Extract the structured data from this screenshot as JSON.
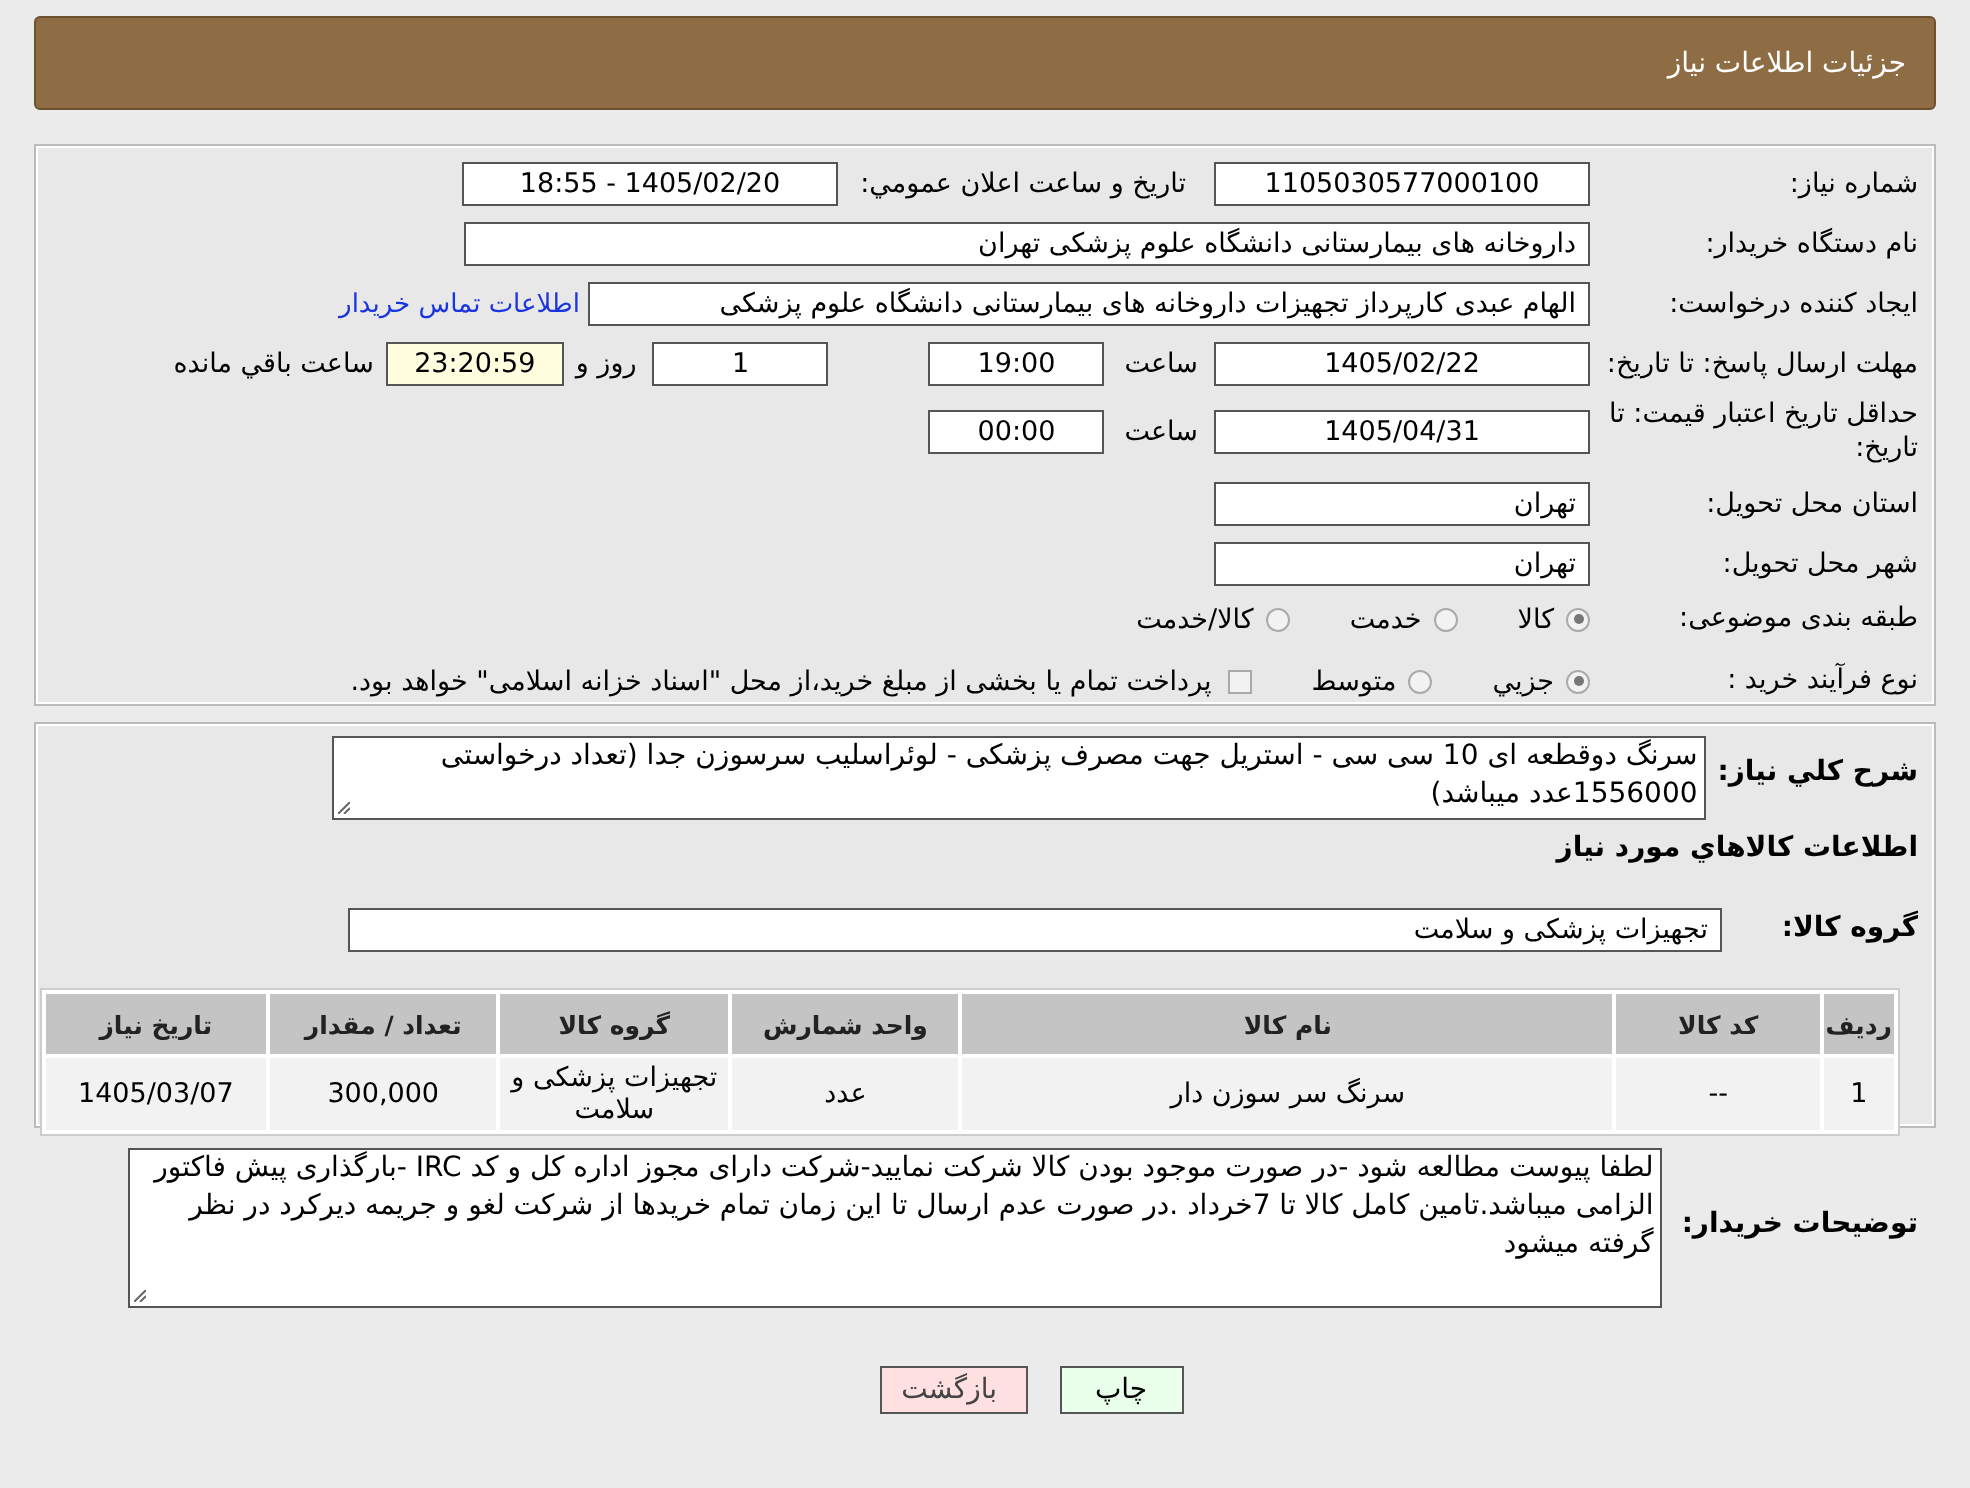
{
  "header": {
    "title": "جزئیات اطلاعات نیاز"
  },
  "form": {
    "need_number": {
      "label": "شماره نیاز:",
      "value": "1105030577000100"
    },
    "announce_datetime": {
      "label": "تاریخ و ساعت اعلان عمومي:",
      "value": "1405/02/20 - 18:55"
    },
    "buyer_org": {
      "label": "نام دستگاه خریدار:",
      "value": "داروخانه های بیمارستانی دانشگاه علوم پزشکی تهران"
    },
    "requester": {
      "label": "ایجاد کننده درخواست:",
      "value": "الهام عبدی کارپرداز تجهیزات داروخانه های بیمارستانی دانشگاه علوم پزشکی",
      "contact_link": "اطلاعات تماس خریدار"
    },
    "reply_deadline": {
      "label": "مهلت ارسال پاسخ: تا تاریخ:",
      "date": "1405/02/22",
      "time_label": "ساعت",
      "time": "19:00",
      "days": "1",
      "days_label": "روز و",
      "remaining": "23:20:59",
      "remaining_label": "ساعت باقي مانده"
    },
    "price_validity": {
      "label": "حداقل تاریخ اعتبار قیمت: تا تاریخ:",
      "date": "1405/04/31",
      "time_label": "ساعت",
      "time": "00:00"
    },
    "province": {
      "label": "استان محل تحویل:",
      "value": "تهران"
    },
    "city": {
      "label": "شهر محل تحویل:",
      "value": "تهران"
    },
    "category": {
      "label": "طبقه بندی موضوعی:",
      "options": [
        {
          "label": "کالا",
          "selected": true
        },
        {
          "label": "خدمت",
          "selected": false
        },
        {
          "label": "کالا/خدمت",
          "selected": false
        }
      ]
    },
    "process": {
      "label": "نوع فرآیند خرید :",
      "options": [
        {
          "label": "جزيي",
          "selected": true
        },
        {
          "label": "متوسط",
          "selected": false
        }
      ],
      "note": "پرداخت تمام یا بخشی از مبلغ خرید،از محل \"اسناد خزانه اسلامی\" خواهد بود."
    }
  },
  "summary": {
    "label": "شرح كلي نياز:",
    "text": "سرنگ دوقطعه ای 10 سی سی - استریل جهت مصرف پزشکی - لوئراسلیب سرسوزن جدا (تعداد درخواستی 1556000عدد میباشد)"
  },
  "goods_title": "اطلاعات كالاهاي مورد نياز",
  "goods_group": {
    "label": "گروه کالا:",
    "value": "تجهیزات پزشکی و سلامت"
  },
  "table": {
    "columns": [
      "ردیف",
      "کد کالا",
      "نام کالا",
      "واحد شمارش",
      "گروه کالا",
      "تعداد / مقدار",
      "تاریخ نیاز"
    ],
    "rows": [
      [
        "1",
        "--",
        "سرنگ سر سوزن دار",
        "عدد",
        "تجهیزات پزشکی و سلامت",
        "300,000",
        "1405/03/07"
      ]
    ]
  },
  "buyer_notes": {
    "label": "توضیحات خریدار:",
    "text": "لطفا پیوست مطالعه شود -در صورت موجود بودن کالا شرکت نمایید-شرکت دارای مجوز اداره کل و کد IRC -بارگذاری پیش فاکتور الزامی میباشد.تامین کامل کالا تا 7خرداد .در صورت عدم ارسال تا این زمان تمام خریدها از شرکت لغو و جریمه دیرکرد در نظر گرفته میشود"
  },
  "buttons": [
    {
      "label": "چاپ",
      "kind": "print"
    },
    {
      "label": "بازگشت",
      "kind": "back"
    }
  ]
}
